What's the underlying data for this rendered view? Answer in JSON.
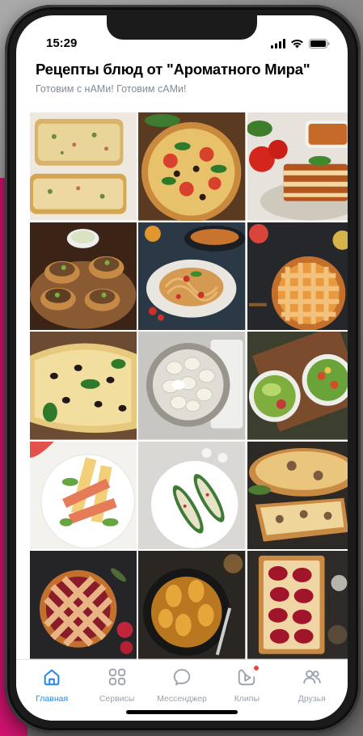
{
  "status_bar": {
    "time": "15:29"
  },
  "header": {
    "title": "Рецепты блюд от \"Ароматного Мира\"",
    "subtitle": "Готовим с нАМи! Готовим сАМи!"
  },
  "gallery": {
    "tiles": [
      {
        "name": "zucchini-bread-photo"
      },
      {
        "name": "pizza-photo"
      },
      {
        "name": "lasagna-photo"
      },
      {
        "name": "stuffed-potatoes-photo"
      },
      {
        "name": "spaghetti-photo"
      },
      {
        "name": "lattice-pie-photo"
      },
      {
        "name": "olive-flatbread-photo"
      },
      {
        "name": "dumplings-photo"
      },
      {
        "name": "avocado-salad-photo"
      },
      {
        "name": "grilled-halloumi-salad-photo"
      },
      {
        "name": "stuffed-zucchini-photo"
      },
      {
        "name": "quiche-photo"
      },
      {
        "name": "cherry-lattice-pie-photo"
      },
      {
        "name": "pear-tart-photo"
      },
      {
        "name": "poached-pear-tart-photo"
      }
    ]
  },
  "tabbar": {
    "tabs": [
      {
        "label": "Главная",
        "icon": "home-icon",
        "active": true
      },
      {
        "label": "Сервисы",
        "icon": "services-grid-icon",
        "active": false
      },
      {
        "label": "Мессенджер",
        "icon": "messenger-icon",
        "active": false
      },
      {
        "label": "Клипы",
        "icon": "clips-icon",
        "active": false,
        "badge": true
      },
      {
        "label": "Друзья",
        "icon": "friends-icon",
        "active": false
      }
    ]
  },
  "colors": {
    "accent": "#2688eb",
    "inactive": "#99a2ad",
    "subtitle": "#818c99",
    "badge": "#e64646",
    "brand_strip": "#d0136f"
  }
}
